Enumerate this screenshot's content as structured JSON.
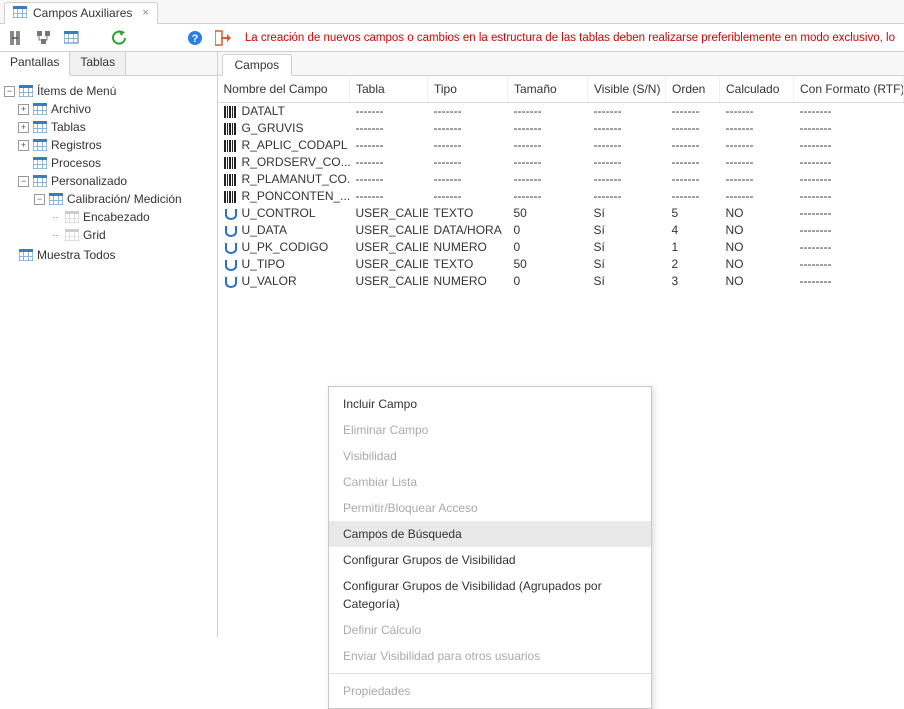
{
  "window": {
    "tab_title": "Campos Auxiliares"
  },
  "toolbar": {
    "warning": "La creación de nuevos campos o cambios en la estructura de las tablas deben realizarse preferiblemente en modo exclusivo, lo c"
  },
  "left": {
    "tabs": {
      "pantallas": "Pantallas",
      "tablas": "Tablas"
    },
    "tree": {
      "root": "Ítems de Menú",
      "archivo": "Archivo",
      "tablas": "Tablas",
      "registros": "Registros",
      "procesos": "Procesos",
      "personalizado": "Personalizado",
      "calibracion": "Calibración/ Medición",
      "encabezado": "Encabezado",
      "grid": "Grid",
      "muestra_todos": "Muestra Todos"
    }
  },
  "right": {
    "tab": "Campos",
    "columns": {
      "nombre": "Nombre del Campo",
      "tabla": "Tabla",
      "tipo": "Tipo",
      "tamano": "Tamaño",
      "visible": "Visible (S/N)",
      "orden": "Orden",
      "calculado": "Calculado",
      "formato": "Con Formato (RTF)"
    },
    "rows": [
      {
        "icon": "sys",
        "nombre": "DATALT",
        "tabla": "-------",
        "tipo": "-------",
        "tamano": "-------",
        "visible": "-------",
        "orden": "-------",
        "calculado": "-------",
        "formato": "--------"
      },
      {
        "icon": "sys",
        "nombre": "G_GRUVIS",
        "tabla": "-------",
        "tipo": "-------",
        "tamano": "-------",
        "visible": "-------",
        "orden": "-------",
        "calculado": "-------",
        "formato": "--------"
      },
      {
        "icon": "sys",
        "nombre": "R_APLIC_CODAPL",
        "tabla": "-------",
        "tipo": "-------",
        "tamano": "-------",
        "visible": "-------",
        "orden": "-------",
        "calculado": "-------",
        "formato": "--------"
      },
      {
        "icon": "sys",
        "nombre": "R_ORDSERV_CO...",
        "tabla": "-------",
        "tipo": "-------",
        "tamano": "-------",
        "visible": "-------",
        "orden": "-------",
        "calculado": "-------",
        "formato": "--------"
      },
      {
        "icon": "sys",
        "nombre": "R_PLAMANUT_CO...",
        "tabla": "-------",
        "tipo": "-------",
        "tamano": "-------",
        "visible": "-------",
        "orden": "-------",
        "calculado": "-------",
        "formato": "--------"
      },
      {
        "icon": "sys",
        "nombre": "R_PONCONTEN_...",
        "tabla": "-------",
        "tipo": "-------",
        "tamano": "-------",
        "visible": "-------",
        "orden": "-------",
        "calculado": "-------",
        "formato": "--------"
      },
      {
        "icon": "usr",
        "nombre": "U_CONTROL",
        "tabla": "USER_CALIB",
        "tipo": "TEXTO",
        "tamano": "50",
        "visible": "Sí",
        "orden": "5",
        "calculado": "NO",
        "formato": "--------"
      },
      {
        "icon": "usr",
        "nombre": "U_DATA",
        "tabla": "USER_CALIB",
        "tipo": "DATA/HORA",
        "tamano": "0",
        "visible": "Sí",
        "orden": "4",
        "calculado": "NO",
        "formato": "--------"
      },
      {
        "icon": "usr",
        "nombre": "U_PK_CODIGO",
        "tabla": "USER_CALIB",
        "tipo": "NUMERO",
        "tamano": "0",
        "visible": "Sí",
        "orden": "1",
        "calculado": "NO",
        "formato": "--------"
      },
      {
        "icon": "usr",
        "nombre": "U_TIPO",
        "tabla": "USER_CALIB",
        "tipo": "TEXTO",
        "tamano": "50",
        "visible": "Sí",
        "orden": "2",
        "calculado": "NO",
        "formato": "--------"
      },
      {
        "icon": "usr",
        "nombre": "U_VALOR",
        "tabla": "USER_CALIB",
        "tipo": "NUMERO",
        "tamano": "0",
        "visible": "Sí",
        "orden": "3",
        "calculado": "NO",
        "formato": "--------"
      }
    ]
  },
  "context_menu": {
    "items": [
      {
        "label": "Incluir Campo",
        "enabled": true,
        "sep": false
      },
      {
        "label": "Eliminar Campo",
        "enabled": false,
        "sep": false
      },
      {
        "label": "Visibilidad",
        "enabled": false,
        "sep": false
      },
      {
        "label": "Cambiar Lista",
        "enabled": false,
        "sep": false
      },
      {
        "label": "Permitir/Bloquear Acceso",
        "enabled": false,
        "sep": false
      },
      {
        "label": "Campos de Búsqueda",
        "enabled": true,
        "hover": true,
        "sep": false
      },
      {
        "label": "Configurar Grupos de Visibilidad",
        "enabled": true,
        "sep": false
      },
      {
        "label": "Configurar Grupos de Visibilidad (Agrupados por Categoría)",
        "enabled": true,
        "sep": false
      },
      {
        "label": "Definir Cálculo",
        "enabled": false,
        "sep": false
      },
      {
        "label": "Enviar Visibilidad para otros usuarios",
        "enabled": false,
        "sep": true
      },
      {
        "label": "Propiedades",
        "enabled": false,
        "sep": false
      }
    ]
  }
}
